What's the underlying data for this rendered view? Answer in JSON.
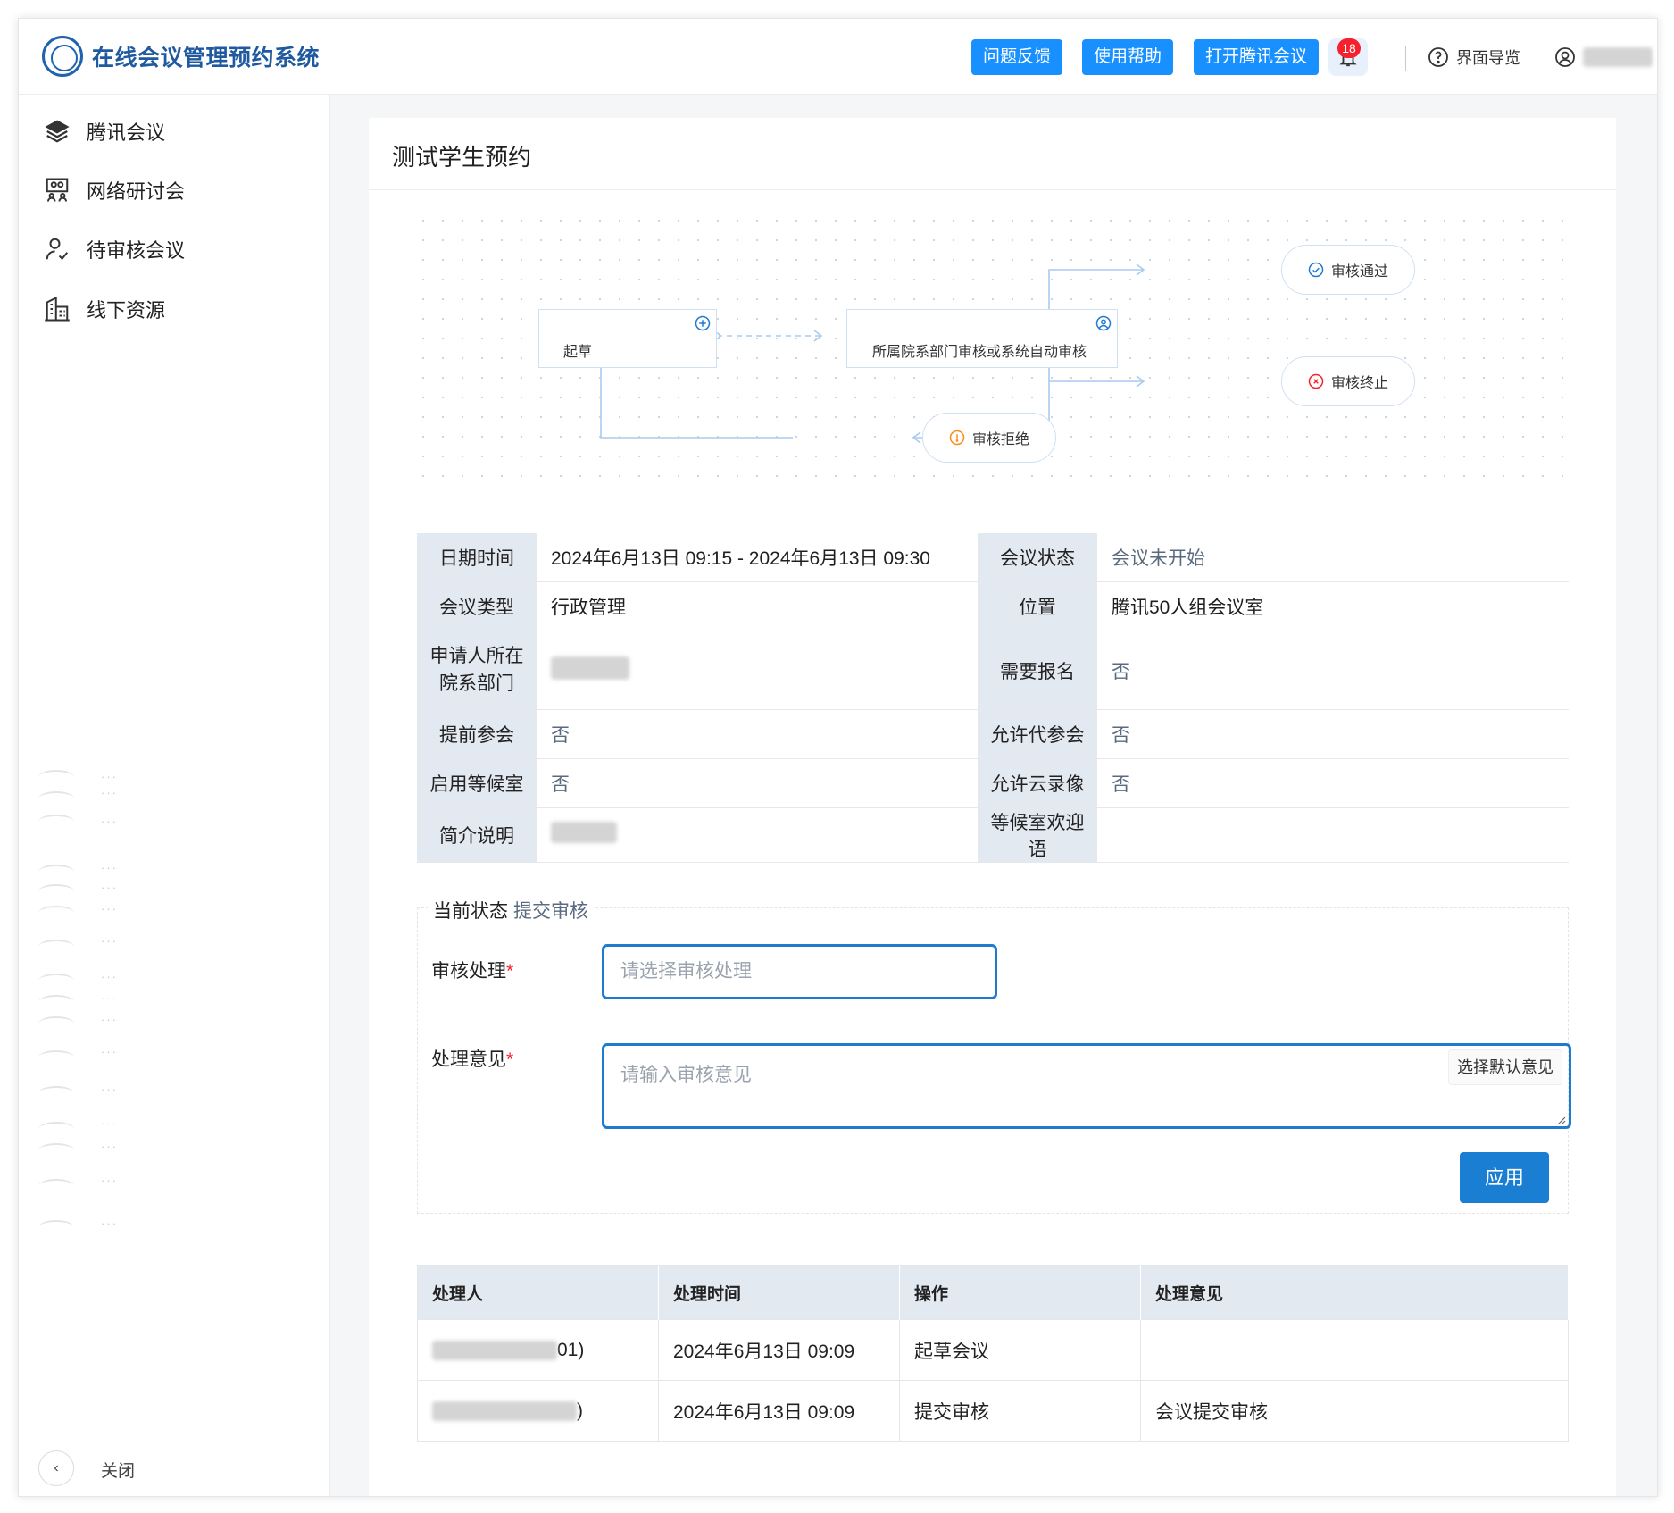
{
  "header": {
    "app_title": "在线会议管理预约系统",
    "buttons": [
      "问题反馈",
      "使用帮助",
      "打开腾讯会议"
    ],
    "notification_count": "18",
    "guide_label": "界面导览",
    "accent_color": "#1890ff"
  },
  "sidebar": {
    "items": [
      {
        "label": "腾讯会议",
        "icon": "layers-icon"
      },
      {
        "label": "网络研讨会",
        "icon": "group-presentation-icon"
      },
      {
        "label": "待审核会议",
        "icon": "user-check-icon"
      },
      {
        "label": "线下资源",
        "icon": "building-icon"
      }
    ],
    "collapse_label": "关闭"
  },
  "page": {
    "title": "测试学生预约"
  },
  "flow": {
    "start": "起草",
    "review": "所属院系部门审核或系统自动审核",
    "approved": "审核通过",
    "terminated": "审核终止",
    "rejected": "审核拒绝"
  },
  "info": {
    "rows": [
      {
        "l1": "日期时间",
        "v1": "2024年6月13日 09:15 - 2024年6月13日 09:30",
        "l2": "会议状态",
        "v2": "会议未开始"
      },
      {
        "l1": "会议类型",
        "v1": "行政管理",
        "l2": "位置",
        "v2": "腾讯50人组会议室"
      },
      {
        "l1": "申请人所在院系部门",
        "v1": "",
        "l2": "需要报名",
        "v2": "否"
      },
      {
        "l1": "提前参会",
        "v1": "否",
        "l2": "允许代参会",
        "v2": "否"
      },
      {
        "l1": "启用等候室",
        "v1": "否",
        "l2": "允许云录像",
        "v2": "否"
      },
      {
        "l1": "简介说明",
        "v1": "",
        "l2": "等候室欢迎语",
        "v2": ""
      }
    ]
  },
  "form": {
    "status_label": "当前状态",
    "status_value": "提交审核",
    "review_label": "审核处理",
    "review_placeholder": "请选择审核处理",
    "opinion_label": "处理意见",
    "opinion_placeholder": "请输入审核意见",
    "default_btn": "选择默认意见",
    "apply_btn": "应用"
  },
  "log": {
    "headers": [
      "处理人",
      "处理时间",
      "操作",
      "处理意见"
    ],
    "rows": [
      {
        "handler_suffix": "01)",
        "time": "2024年6月13日 09:09",
        "action": "起草会议",
        "opinion": ""
      },
      {
        "handler_suffix": ")",
        "time": "2024年6月13日 09:09",
        "action": "提交审核",
        "opinion": "会议提交审核"
      }
    ]
  }
}
